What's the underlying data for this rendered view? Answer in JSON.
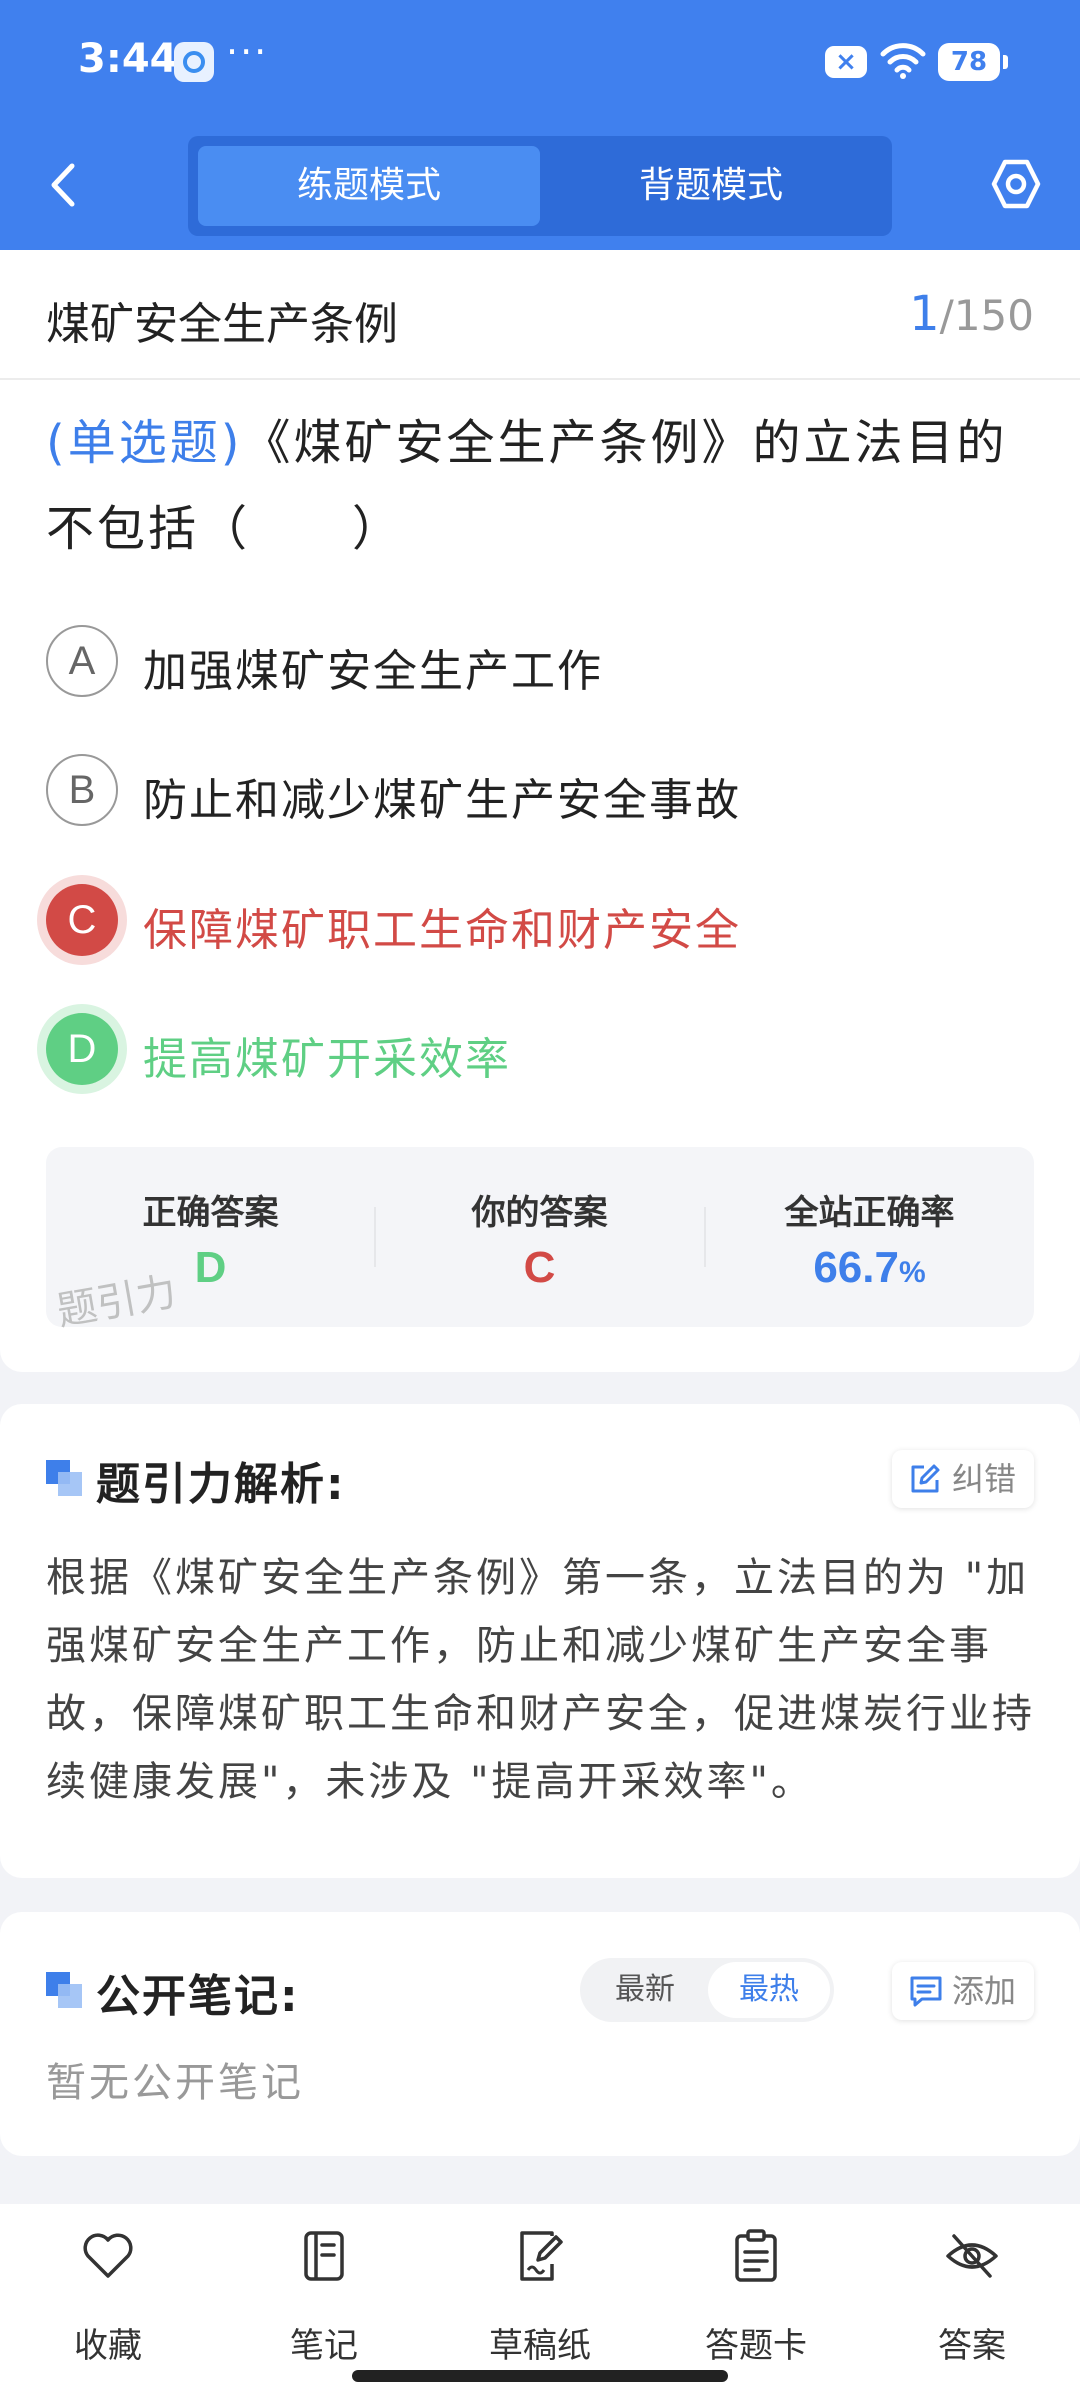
{
  "status_bar": {
    "time": "3:44",
    "more": "···",
    "close_badge": "×",
    "battery": "78"
  },
  "header": {
    "modes": [
      "练题模式",
      "背题模式"
    ],
    "active_mode": "练题模式"
  },
  "question": {
    "title": "煤矿安全生产条例",
    "current": "1",
    "total": "/150",
    "type_label": "(单选题)",
    "text": "《煤矿安全生产条例》的立法目的不包括（　　）",
    "options": [
      {
        "letter": "A",
        "text": "加强煤矿安全生产工作",
        "state": "normal"
      },
      {
        "letter": "B",
        "text": "防止和减少煤矿生产安全事故",
        "state": "normal"
      },
      {
        "letter": "C",
        "text": "保障煤矿职工生命和财产安全",
        "state": "wrong"
      },
      {
        "letter": "D",
        "text": "提高煤矿开采效率",
        "state": "correct"
      }
    ]
  },
  "result": {
    "correct_label": "正确答案",
    "correct_value": "D",
    "yours_label": "你的答案",
    "yours_value": "C",
    "rate_label": "全站正确率",
    "rate_value": "66.7",
    "rate_unit": "%",
    "watermark": "题引力"
  },
  "analysis": {
    "title": "题引力解析:",
    "report_label": "纠错",
    "body": "根据《煤矿安全生产条例》第一条，立法目的为 \"加强煤矿安全生产工作，防止和减少煤矿生产安全事故，保障煤矿职工生命和财产安全，促进煤炭行业持续健康发展\"，未涉及 \"提高开采效率\"。"
  },
  "notes": {
    "title": "公开笔记:",
    "sort_latest": "最新",
    "sort_hot": "最热",
    "active_sort": "最热",
    "add_label": "添加",
    "empty_text": "暂无公开笔记"
  },
  "bottom_bar": {
    "items": [
      {
        "label": "收藏",
        "icon": "heart-icon"
      },
      {
        "label": "笔记",
        "icon": "notebook-icon"
      },
      {
        "label": "草稿纸",
        "icon": "draft-paper-icon"
      },
      {
        "label": "答题卡",
        "icon": "answer-card-icon"
      },
      {
        "label": "答案",
        "icon": "eye-off-icon"
      }
    ]
  },
  "colors": {
    "primary": "#4080ee",
    "wrong": "#d24a46",
    "correct": "#5fcf84"
  }
}
